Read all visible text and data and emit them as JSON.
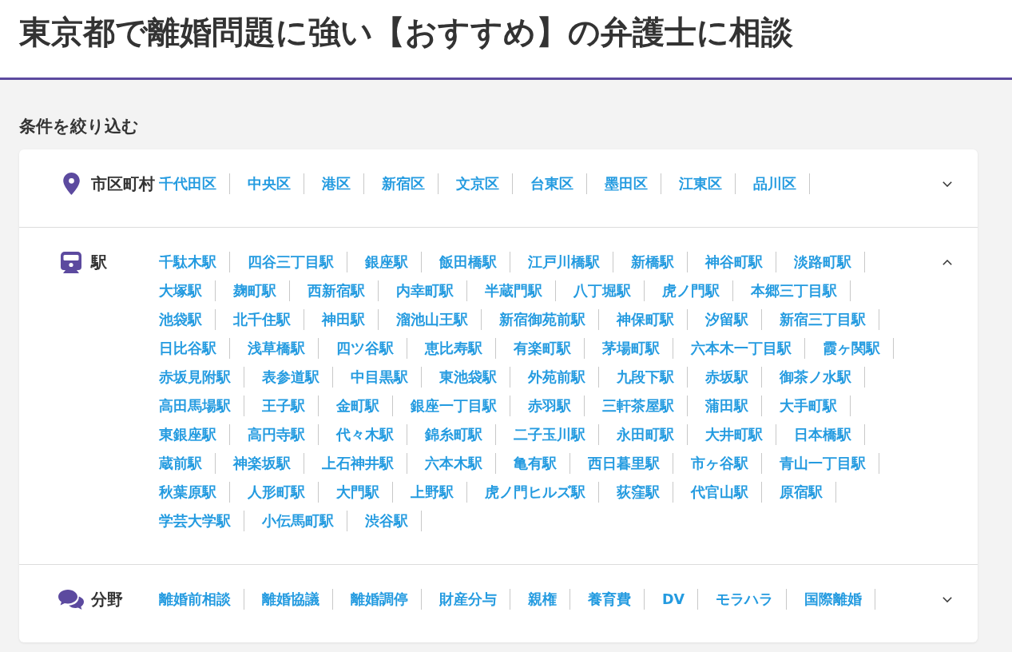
{
  "title": "東京都で離婚問題に強い【おすすめ】の弁護士に相談",
  "filter_heading": "条件を絞り込む",
  "sections": [
    {
      "kind": "area",
      "label": "市区町村",
      "expanded": false,
      "items": [
        "千代田区",
        "中央区",
        "港区",
        "新宿区",
        "文京区",
        "台東区",
        "墨田区",
        "江東区",
        "品川区"
      ]
    },
    {
      "kind": "station",
      "label": "駅",
      "expanded": true,
      "items": [
        "千駄木駅",
        "四谷三丁目駅",
        "銀座駅",
        "飯田橋駅",
        "江戸川橋駅",
        "新橋駅",
        "神谷町駅",
        "淡路町駅",
        "大塚駅",
        "麹町駅",
        "西新宿駅",
        "内幸町駅",
        "半蔵門駅",
        "八丁堀駅",
        "虎ノ門駅",
        "本郷三丁目駅",
        "池袋駅",
        "北千住駅",
        "神田駅",
        "溜池山王駅",
        "新宿御苑前駅",
        "神保町駅",
        "汐留駅",
        "新宿三丁目駅",
        "日比谷駅",
        "浅草橋駅",
        "四ツ谷駅",
        "恵比寿駅",
        "有楽町駅",
        "茅場町駅",
        "六本木一丁目駅",
        "霞ヶ関駅",
        "赤坂見附駅",
        "表参道駅",
        "中目黒駅",
        "東池袋駅",
        "外苑前駅",
        "九段下駅",
        "赤坂駅",
        "御茶ノ水駅",
        "高田馬場駅",
        "王子駅",
        "金町駅",
        "銀座一丁目駅",
        "赤羽駅",
        "三軒茶屋駅",
        "蒲田駅",
        "大手町駅",
        "東銀座駅",
        "高円寺駅",
        "代々木駅",
        "錦糸町駅",
        "二子玉川駅",
        "永田町駅",
        "大井町駅",
        "日本橋駅",
        "蔵前駅",
        "神楽坂駅",
        "上石神井駅",
        "六本木駅",
        "亀有駅",
        "西日暮里駅",
        "市ヶ谷駅",
        "青山一丁目駅",
        "秋葉原駅",
        "人形町駅",
        "大門駅",
        "上野駅",
        "虎ノ門ヒルズ駅",
        "荻窪駅",
        "代官山駅",
        "原宿駅",
        "学芸大学駅",
        "小伝馬町駅",
        "渋谷駅"
      ]
    },
    {
      "kind": "field",
      "label": "分野",
      "expanded": false,
      "items": [
        "離婚前相談",
        "離婚協議",
        "離婚調停",
        "財産分与",
        "親権",
        "養育費",
        "DV",
        "モラハラ",
        "国際離婚"
      ]
    }
  ]
}
